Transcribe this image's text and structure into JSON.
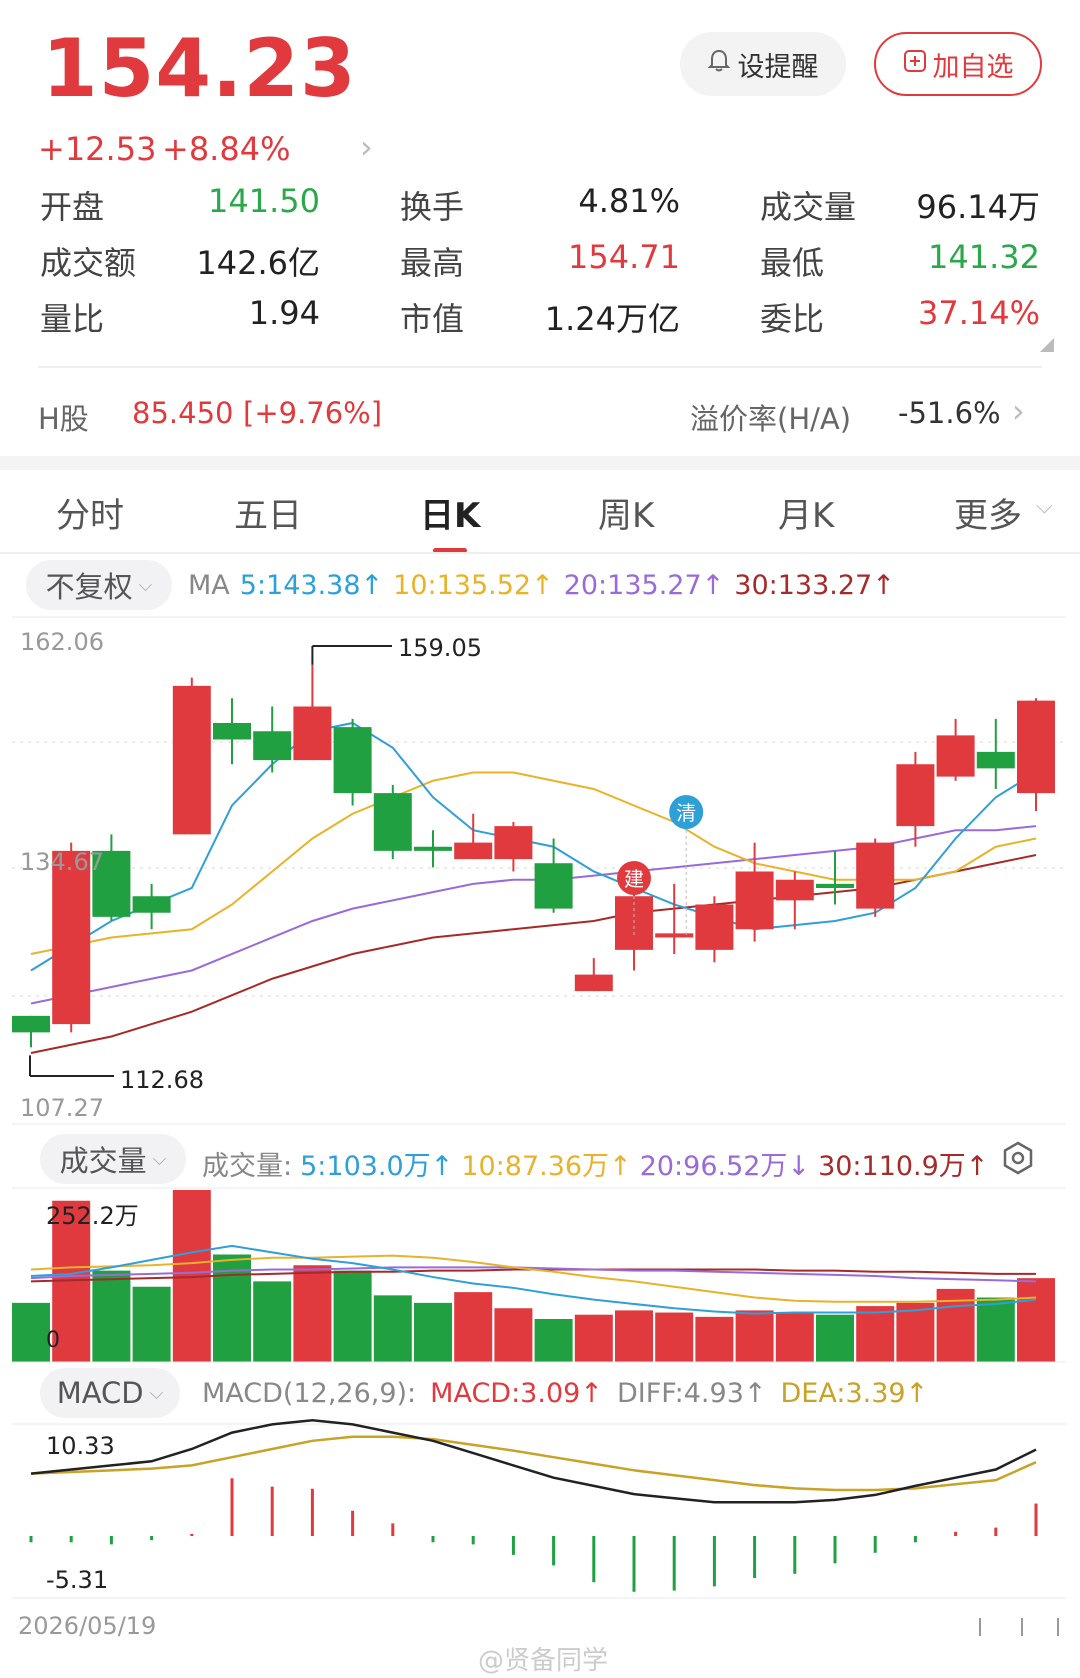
{
  "quote": {
    "price": "154.23",
    "change": "+12.53",
    "change_pct": "+8.84%"
  },
  "buttons": {
    "remind": "设提醒",
    "add_watchlist": "加自选"
  },
  "stats": [
    {
      "label": "开盘",
      "value": "141.50",
      "color": "#2aa84a"
    },
    {
      "label": "换手",
      "value": "4.81%",
      "color": "#222222"
    },
    {
      "label": "成交量",
      "value": "96.14万",
      "color": "#222222"
    },
    {
      "label": "成交额",
      "value": "142.6亿",
      "color": "#222222"
    },
    {
      "label": "最高",
      "value": "154.71",
      "color": "#e03a3e"
    },
    {
      "label": "最低",
      "value": "141.32",
      "color": "#2aa84a"
    },
    {
      "label": "量比",
      "value": "1.94",
      "color": "#222222"
    },
    {
      "label": "市值",
      "value": "1.24万亿",
      "color": "#222222"
    },
    {
      "label": "委比",
      "value": "37.14%",
      "color": "#e03a3e"
    }
  ],
  "h_share": {
    "label": "H股",
    "value": "85.450",
    "change": "[+9.76%]",
    "premium_label": "溢价率(H/A)",
    "premium_value": "-51.6%"
  },
  "tabs": [
    {
      "label": "分时",
      "active": false
    },
    {
      "label": "五日",
      "active": false
    },
    {
      "label": "日K",
      "active": true
    },
    {
      "label": "周K",
      "active": false
    },
    {
      "label": "月K",
      "active": false
    },
    {
      "label": "更多",
      "active": false
    }
  ],
  "ma_bar": {
    "selector": "不复权",
    "prefix": "MA",
    "items": [
      {
        "text": "5:143.38↑",
        "color": "#2f9fd8"
      },
      {
        "text": "10:135.52↑",
        "color": "#e8b22a"
      },
      {
        "text": "20:135.27↑",
        "color": "#9a6bd8"
      },
      {
        "text": "30:133.27↑",
        "color": "#a52a2a"
      }
    ]
  },
  "vol_bar": {
    "selector": "成交量",
    "prefix": "成交量:",
    "items": [
      {
        "text": "5:103.0万↑",
        "color": "#2f9fd8"
      },
      {
        "text": "10:87.36万↑",
        "color": "#e8b22a"
      },
      {
        "text": "20:96.52万↓",
        "color": "#9a6bd8"
      },
      {
        "text": "30:110.9万↑",
        "color": "#a52a2a"
      }
    ]
  },
  "macd_bar": {
    "selector": "MACD",
    "prefix": "MACD(12,26,9):",
    "items": [
      {
        "text": "MACD:3.09↑",
        "color": "#e03a3e"
      },
      {
        "text": "DIFF:4.93↑",
        "color": "#888888"
      },
      {
        "text": "DEA:3.39↑",
        "color": "#c9a227"
      }
    ]
  },
  "kline_axis": {
    "top": "162.06",
    "mid": "134.67",
    "bottom": "107.27"
  },
  "vol_axis": {
    "top": "252.2万",
    "bottom": "0"
  },
  "macd_axis": {
    "top": "10.33",
    "bottom": "-5.31"
  },
  "annotations": {
    "high": "159.05",
    "low": "112.68",
    "mark_jian": "建",
    "mark_qing": "清"
  },
  "date": "2026/05/19",
  "watermark": "@贤备同学",
  "chart_data": {
    "type": "candlestick",
    "ylim": [
      107.27,
      162.06
    ],
    "candles": [
      {
        "o": 116.5,
        "c": 114.5,
        "h": 116.5,
        "l": 112.68
      },
      {
        "o": 115.5,
        "c": 136.5,
        "h": 137.5,
        "l": 114.5
      },
      {
        "o": 136.5,
        "c": 128.5,
        "h": 138.5,
        "l": 128.0
      },
      {
        "o": 131.0,
        "c": 129.0,
        "h": 132.5,
        "l": 127.0
      },
      {
        "o": 138.5,
        "c": 156.5,
        "h": 157.5,
        "l": 138.5
      },
      {
        "o": 152.0,
        "c": 150.0,
        "h": 155.0,
        "l": 147.0
      },
      {
        "o": 151.0,
        "c": 147.5,
        "h": 154.0,
        "l": 146.0
      },
      {
        "o": 147.5,
        "c": 154.0,
        "h": 159.05,
        "l": 147.5
      },
      {
        "o": 151.5,
        "c": 143.5,
        "h": 152.5,
        "l": 142.0
      },
      {
        "o": 143.5,
        "c": 136.5,
        "h": 144.5,
        "l": 135.5
      },
      {
        "o": 137.0,
        "c": 136.5,
        "h": 139.0,
        "l": 134.5
      },
      {
        "o": 135.5,
        "c": 137.5,
        "h": 141.0,
        "l": 135.5
      },
      {
        "o": 135.5,
        "c": 139.5,
        "h": 140.0,
        "l": 134.0
      },
      {
        "o": 135.0,
        "c": 129.5,
        "h": 138.0,
        "l": 129.0
      },
      {
        "o": 119.5,
        "c": 121.5,
        "h": 123.5,
        "l": 119.5
      },
      {
        "o": 124.5,
        "c": 131.0,
        "h": 132.0,
        "l": 122.0
      },
      {
        "o": 126.0,
        "c": 126.5,
        "h": 132.5,
        "l": 124.0
      },
      {
        "o": 124.5,
        "c": 130.0,
        "h": 131.0,
        "l": 123.0
      },
      {
        "o": 127.0,
        "c": 134.0,
        "h": 137.5,
        "l": 125.5
      },
      {
        "o": 130.5,
        "c": 133.0,
        "h": 134.0,
        "l": 127.0
      },
      {
        "o": 132.5,
        "c": 132.0,
        "h": 136.5,
        "l": 130.0
      },
      {
        "o": 129.5,
        "c": 137.5,
        "h": 138.0,
        "l": 128.5
      },
      {
        "o": 139.5,
        "c": 147.0,
        "h": 148.5,
        "l": 137.0
      },
      {
        "o": 145.5,
        "c": 150.5,
        "h": 152.5,
        "l": 145.0
      },
      {
        "o": 148.5,
        "c": 146.5,
        "h": 152.5,
        "l": 144.0
      },
      {
        "o": 143.5,
        "c": 154.71,
        "h": 155.0,
        "l": 141.32
      }
    ],
    "ma5": [
      122,
      125,
      128,
      130,
      132,
      142,
      147,
      151,
      152,
      149,
      143,
      139,
      138,
      137,
      134,
      132,
      130,
      128.5,
      127,
      127.5,
      128,
      129,
      132,
      138,
      143,
      146
    ],
    "ma10": [
      124,
      125,
      126,
      126.5,
      127,
      130,
      134,
      138,
      141,
      143,
      145,
      146,
      146,
      145,
      144,
      142,
      140,
      137,
      135,
      134,
      133,
      133,
      133,
      134,
      137,
      138
    ],
    "ma20": [
      118,
      119,
      120,
      121,
      122,
      124,
      126,
      128,
      129.5,
      130.5,
      131.5,
      132.5,
      133,
      133,
      133.5,
      134,
      134.5,
      135,
      135.5,
      136,
      136.5,
      137,
      138,
      139,
      139,
      139.5
    ],
    "ma30": [
      112,
      113,
      114,
      115.5,
      117,
      119,
      121,
      122.5,
      124,
      125,
      126,
      126.5,
      127,
      127.5,
      128,
      129,
      129.5,
      130,
      130.5,
      131,
      131.5,
      132,
      133,
      134,
      135,
      136
    ],
    "volume": [
      55,
      150,
      85,
      70,
      160,
      100,
      75,
      90,
      85,
      62,
      55,
      65,
      50,
      40,
      44,
      48,
      46,
      42,
      48,
      46,
      44,
      52,
      55,
      68,
      60,
      78
    ],
    "vol_ma5": [
      80,
      82,
      88,
      95,
      102,
      108,
      102,
      96,
      92,
      86,
      79,
      73,
      69,
      63,
      58,
      54,
      50,
      47,
      45,
      46,
      46,
      46,
      48,
      52,
      54,
      58
    ],
    "vol_ma10": [
      86,
      88,
      89,
      90,
      92,
      95,
      97,
      97,
      98,
      99,
      97,
      93,
      88,
      84,
      79,
      75,
      70,
      65,
      60,
      57,
      56,
      56,
      56,
      57,
      58,
      60
    ],
    "vol_ma20": [
      78,
      80,
      81,
      82,
      83,
      85,
      86,
      86,
      87,
      88,
      88,
      88,
      88,
      87,
      86,
      85,
      85,
      84,
      83,
      82,
      81,
      80,
      78,
      77,
      76,
      75
    ],
    "vol_ma30": [
      75,
      76,
      77,
      78,
      79,
      81,
      82,
      83,
      84,
      84,
      85,
      85,
      86,
      86,
      86,
      86,
      86,
      86,
      86,
      85,
      85,
      84,
      84,
      83,
      82,
      82
    ],
    "macd_hist": [
      -0.6,
      -0.6,
      -0.8,
      -0.4,
      0.2,
      5.5,
      4.7,
      4.5,
      2.4,
      1.2,
      -0.6,
      -0.8,
      -1.8,
      -2.8,
      -4.4,
      -5.31,
      -5.2,
      -4.8,
      -4.0,
      -3.6,
      -2.6,
      -1.6,
      -0.6,
      0.4,
      0.8,
      3.09
    ],
    "diff": [
      2.0,
      2.5,
      3.0,
      3.5,
      5.0,
      7.0,
      8.0,
      8.5,
      8.0,
      7.0,
      6.0,
      4.5,
      3.0,
      1.5,
      0.5,
      -0.5,
      -1.0,
      -1.5,
      -1.5,
      -1.5,
      -1.2,
      -0.6,
      0.5,
      1.5,
      2.5,
      4.93
    ],
    "dea": [
      2.0,
      2.2,
      2.4,
      2.6,
      3.0,
      4.0,
      5.0,
      6.0,
      6.5,
      6.5,
      6.2,
      5.5,
      4.8,
      4.0,
      3.2,
      2.4,
      1.8,
      1.2,
      0.6,
      0.2,
      0.0,
      0.0,
      0.2,
      0.7,
      1.2,
      3.39
    ]
  }
}
